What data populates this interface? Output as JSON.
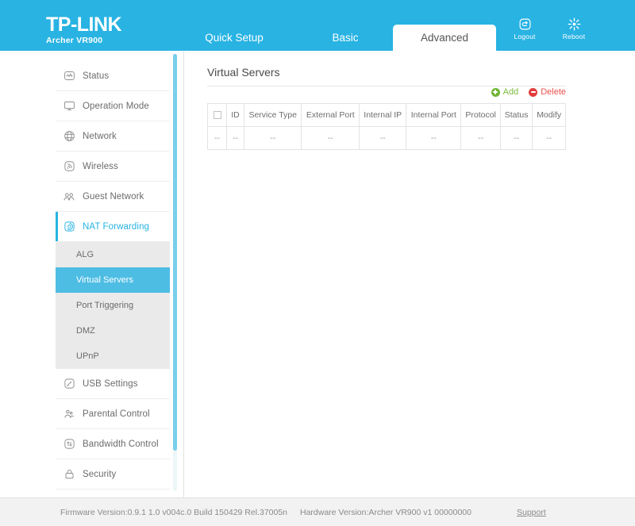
{
  "header": {
    "logo_main": "TP-LINK",
    "logo_sub": "Archer VR900",
    "tabs": [
      {
        "label": "Quick Setup",
        "active": false
      },
      {
        "label": "Basic",
        "active": false
      },
      {
        "label": "Advanced",
        "active": true
      }
    ],
    "buttons": [
      {
        "label": "Logout",
        "icon": "logout-icon"
      },
      {
        "label": "Reboot",
        "icon": "reboot-icon"
      }
    ],
    "bg_color": "#28b3e3"
  },
  "sidebar": {
    "items": [
      {
        "label": "Status",
        "icon": "status-icon",
        "active": false
      },
      {
        "label": "Operation Mode",
        "icon": "monitor-icon",
        "active": false
      },
      {
        "label": "Network",
        "icon": "globe-icon",
        "active": false
      },
      {
        "label": "Wireless",
        "icon": "wireless-signal-icon",
        "active": false
      },
      {
        "label": "Guest Network",
        "icon": "guest-people-icon",
        "active": false
      },
      {
        "label": "NAT Forwarding",
        "icon": "nat-forwarding-icon",
        "active": true
      },
      {
        "label": "USB Settings",
        "icon": "usb-icon",
        "active": false
      },
      {
        "label": "Parental Control",
        "icon": "parental-control-icon",
        "active": false
      },
      {
        "label": "Bandwidth Control",
        "icon": "bandwidth-arrows-icon",
        "active": false
      },
      {
        "label": "Security",
        "icon": "lock-icon",
        "active": false
      }
    ],
    "submenu": [
      {
        "label": "ALG",
        "active": false
      },
      {
        "label": "Virtual Servers",
        "active": true
      },
      {
        "label": "Port Triggering",
        "active": false
      },
      {
        "label": "DMZ",
        "active": false
      },
      {
        "label": "UPnP",
        "active": false
      }
    ],
    "active_color": "#28b3e3",
    "submenu_active_bg": "#4ebde4"
  },
  "main": {
    "page_title": "Virtual Servers",
    "actions": {
      "add_label": "Add",
      "add_icon": "plus-circle-icon",
      "add_color": "#7aba3c",
      "delete_label": "Delete",
      "delete_icon": "minus-circle-icon",
      "delete_color": "#e8534f"
    },
    "table": {
      "columns": [
        "",
        "ID",
        "Service Type",
        "External Port",
        "Internal IP",
        "Internal Port",
        "Protocol",
        "Status",
        "Modify"
      ],
      "rows": [
        [
          "--",
          "--",
          "--",
          "--",
          "--",
          "--",
          "--",
          "--",
          "--"
        ]
      ]
    }
  },
  "footer": {
    "firmware": "Firmware Version:0.9.1 1.0 v004c.0 Build 150429 Rel.37005n",
    "hardware": "Hardware Version:Archer VR900 v1 00000000",
    "support": "Support"
  }
}
